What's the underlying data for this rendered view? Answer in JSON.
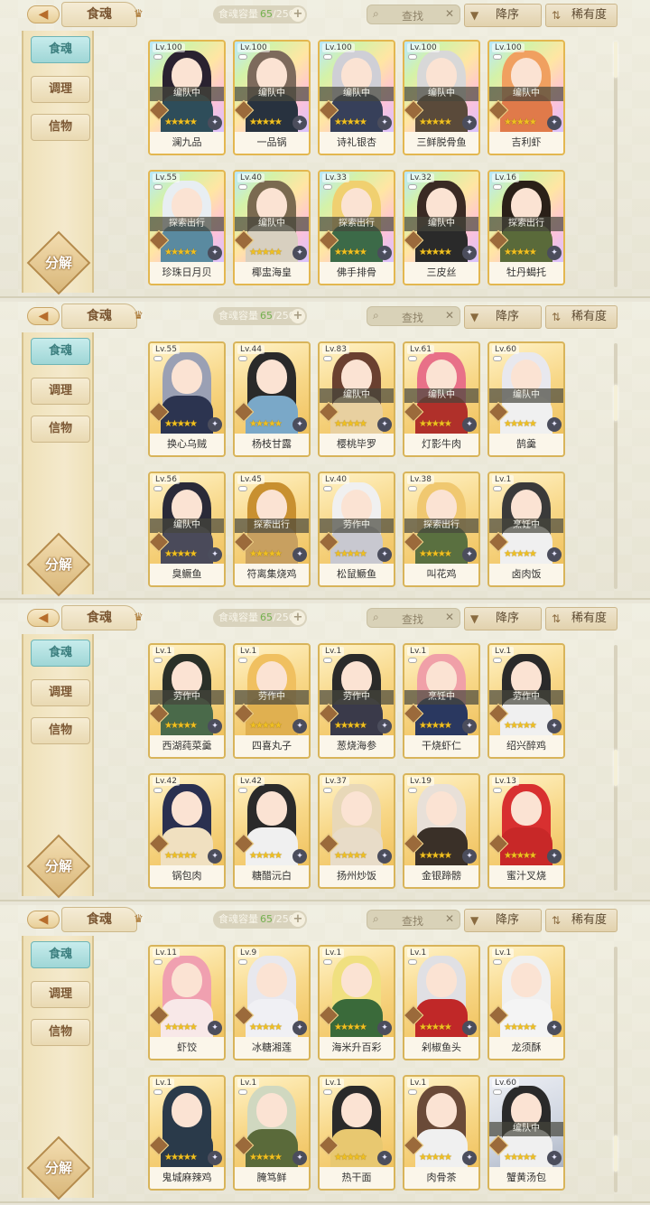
{
  "header": {
    "title": "食魂",
    "capacity_label": "食魂容量",
    "capacity_current": "65",
    "capacity_max": "/250",
    "search_placeholder": "查找",
    "sort_order": "降序",
    "sort_rarity": "稀有度"
  },
  "sidebar": {
    "tabs": [
      "食魂",
      "调理",
      "信物"
    ],
    "decompose": "分解"
  },
  "screens": [
    {
      "cards": [
        {
          "lv": "Lv.100",
          "status": "编队中",
          "name": "澜九品",
          "rarity": "rainbow",
          "hair": "#2a2230",
          "body": "#2e4d5a"
        },
        {
          "lv": "Lv.100",
          "status": "编队中",
          "name": "一品锅",
          "rarity": "rainbow",
          "hair": "#7d6a5c",
          "body": "#28323f"
        },
        {
          "lv": "Lv.100",
          "status": "编队中",
          "name": "诗礼银杏",
          "rarity": "rainbow",
          "hair": "#cfcfd6",
          "body": "#37405a"
        },
        {
          "lv": "Lv.100",
          "status": "编队中",
          "name": "三鲜脱骨鱼",
          "rarity": "rainbow",
          "hair": "#d8d8d8",
          "body": "#5a4a3a"
        },
        {
          "lv": "Lv.100",
          "status": "编队中",
          "name": "吉利虾",
          "rarity": "rainbow",
          "hair": "#f0a060",
          "body": "#e07a4a"
        },
        {
          "lv": "Lv.55",
          "status": "探索出行",
          "name": "珍珠日月贝",
          "rarity": "rainbow",
          "hair": "#e8eef2",
          "body": "#5a8aa0"
        },
        {
          "lv": "Lv.40",
          "status": "编队中",
          "name": "椰盅海皇",
          "rarity": "rainbow",
          "hair": "#7a6a50",
          "body": "#d8d0c0"
        },
        {
          "lv": "Lv.33",
          "status": "探索出行",
          "name": "佛手排骨",
          "rarity": "rainbow",
          "hair": "#f0d070",
          "body": "#3c6a48"
        },
        {
          "lv": "Lv.32",
          "status": "编队中",
          "name": "三皮丝",
          "rarity": "rainbow",
          "hair": "#3a2a24",
          "body": "#2a2a2a"
        },
        {
          "lv": "Lv.16",
          "status": "探索出行",
          "name": "牡丹蝎托",
          "rarity": "rainbow",
          "hair": "#2a2018",
          "body": "#5a6a3a"
        }
      ],
      "scroll": 0.0
    },
    {
      "cards": [
        {
          "lv": "Lv.55",
          "status": "",
          "name": "换心乌贼",
          "rarity": "gold",
          "hair": "#9aa0b4",
          "body": "#2c3450"
        },
        {
          "lv": "Lv.44",
          "status": "",
          "name": "杨枝甘露",
          "rarity": "gold",
          "hair": "#2a2a2a",
          "body": "#7aa8c8"
        },
        {
          "lv": "Lv.83",
          "status": "编队中",
          "name": "樱桃毕罗",
          "rarity": "gold",
          "hair": "#6a4030",
          "body": "#e8d0a0"
        },
        {
          "lv": "Lv.61",
          "status": "编队中",
          "name": "灯影牛肉",
          "rarity": "gold",
          "hair": "#e87088",
          "body": "#b0302a"
        },
        {
          "lv": "Lv.60",
          "status": "编队中",
          "name": "鹄羹",
          "rarity": "gold",
          "hair": "#e8e8ee",
          "body": "#f0f0f0"
        },
        {
          "lv": "Lv.56",
          "status": "编队中",
          "name": "臭鳜鱼",
          "rarity": "gold",
          "hair": "#2a2a38",
          "body": "#4a4a5a"
        },
        {
          "lv": "Lv.45",
          "status": "探索出行",
          "name": "符离集烧鸡",
          "rarity": "gold",
          "hair": "#c89030",
          "body": "#c8a060"
        },
        {
          "lv": "Lv.40",
          "status": "劳作中",
          "name": "松鼠鳜鱼",
          "rarity": "gold",
          "hair": "#f0f0f0",
          "body": "#c8c8d0"
        },
        {
          "lv": "Lv.38",
          "status": "探索出行",
          "name": "叫花鸡",
          "rarity": "gold",
          "hair": "#f0c870",
          "body": "#5a7040"
        },
        {
          "lv": "Lv.1",
          "status": "烹饪中",
          "name": "卤肉饭",
          "rarity": "gold",
          "hair": "#3a3a3a",
          "body": "#f0f0f0"
        }
      ],
      "scroll": 0.2
    },
    {
      "cards": [
        {
          "lv": "Lv.1",
          "status": "劳作中",
          "name": "西湖莼菜羹",
          "rarity": "gold",
          "hair": "#2a3028",
          "body": "#4a6a4a"
        },
        {
          "lv": "Lv.1",
          "status": "劳作中",
          "name": "四喜丸子",
          "rarity": "gold",
          "hair": "#f0c060",
          "body": "#e0b050"
        },
        {
          "lv": "Lv.1",
          "status": "劳作中",
          "name": "葱烧海参",
          "rarity": "gold",
          "hair": "#2a2a2a",
          "body": "#3a3a4a"
        },
        {
          "lv": "Lv.1",
          "status": "烹饪中",
          "name": "干烧虾仁",
          "rarity": "gold",
          "hair": "#f0a0a8",
          "body": "#2a3860"
        },
        {
          "lv": "Lv.1",
          "status": "劳作中",
          "name": "绍兴醉鸡",
          "rarity": "gold",
          "hair": "#2a2a2a",
          "body": "#f0f0f0"
        },
        {
          "lv": "Lv.42",
          "status": "",
          "name": "锅包肉",
          "rarity": "gold",
          "hair": "#2a3050",
          "body": "#f0e0c0"
        },
        {
          "lv": "Lv.42",
          "status": "",
          "name": "糖醋沅白",
          "rarity": "gold",
          "hair": "#2a2a2a",
          "body": "#f0f0f0"
        },
        {
          "lv": "Lv.37",
          "status": "",
          "name": "扬州炒饭",
          "rarity": "gold",
          "hair": "#e8d8b8",
          "body": "#e8dcc8"
        },
        {
          "lv": "Lv.19",
          "status": "",
          "name": "金银蹄髈",
          "rarity": "gold",
          "hair": "#e8e0d8",
          "body": "#3a3028"
        },
        {
          "lv": "Lv.13",
          "status": "",
          "name": "蜜汁叉烧",
          "rarity": "gold",
          "hair": "#d83030",
          "body": "#c82828"
        }
      ],
      "scroll": 0.5
    },
    {
      "cards": [
        {
          "lv": "Lv.11",
          "status": "",
          "name": "虾饺",
          "rarity": "gold",
          "hair": "#f0a0b0",
          "body": "#f8e8e8"
        },
        {
          "lv": "Lv.9",
          "status": "",
          "name": "冰糖湘莲",
          "rarity": "gold",
          "hair": "#e8e8ee",
          "body": "#f0f0f4"
        },
        {
          "lv": "Lv.1",
          "status": "",
          "name": "海米升百彩",
          "rarity": "gold",
          "hair": "#f0e080",
          "body": "#3a6a3a"
        },
        {
          "lv": "Lv.1",
          "status": "",
          "name": "剁椒鱼头",
          "rarity": "gold",
          "hair": "#e0e0e4",
          "body": "#c02828"
        },
        {
          "lv": "Lv.1",
          "status": "",
          "name": "龙须酥",
          "rarity": "gold",
          "hair": "#f0f0f0",
          "body": "#f4f4f4"
        },
        {
          "lv": "Lv.1",
          "status": "",
          "name": "鬼城麻辣鸡",
          "rarity": "gold",
          "hair": "#2a3a4a",
          "body": "#2a3a4a"
        },
        {
          "lv": "Lv.1",
          "status": "",
          "name": "腌笃鲜",
          "rarity": "gold",
          "hair": "#d0d8c0",
          "body": "#5a6a3a"
        },
        {
          "lv": "Lv.1",
          "status": "",
          "name": "热干面",
          "rarity": "gold",
          "hair": "#2a2a2a",
          "body": "#e8c870"
        },
        {
          "lv": "Lv.1",
          "status": "",
          "name": "肉骨茶",
          "rarity": "gold",
          "hair": "#6a4a38",
          "body": "#f0f0f0"
        },
        {
          "lv": "Lv.60",
          "status": "编队中",
          "name": "蟹黄汤包",
          "rarity": "silver",
          "hair": "#2a2a2a",
          "body": "#f0f0f0"
        }
      ],
      "scroll": 0.9
    }
  ]
}
